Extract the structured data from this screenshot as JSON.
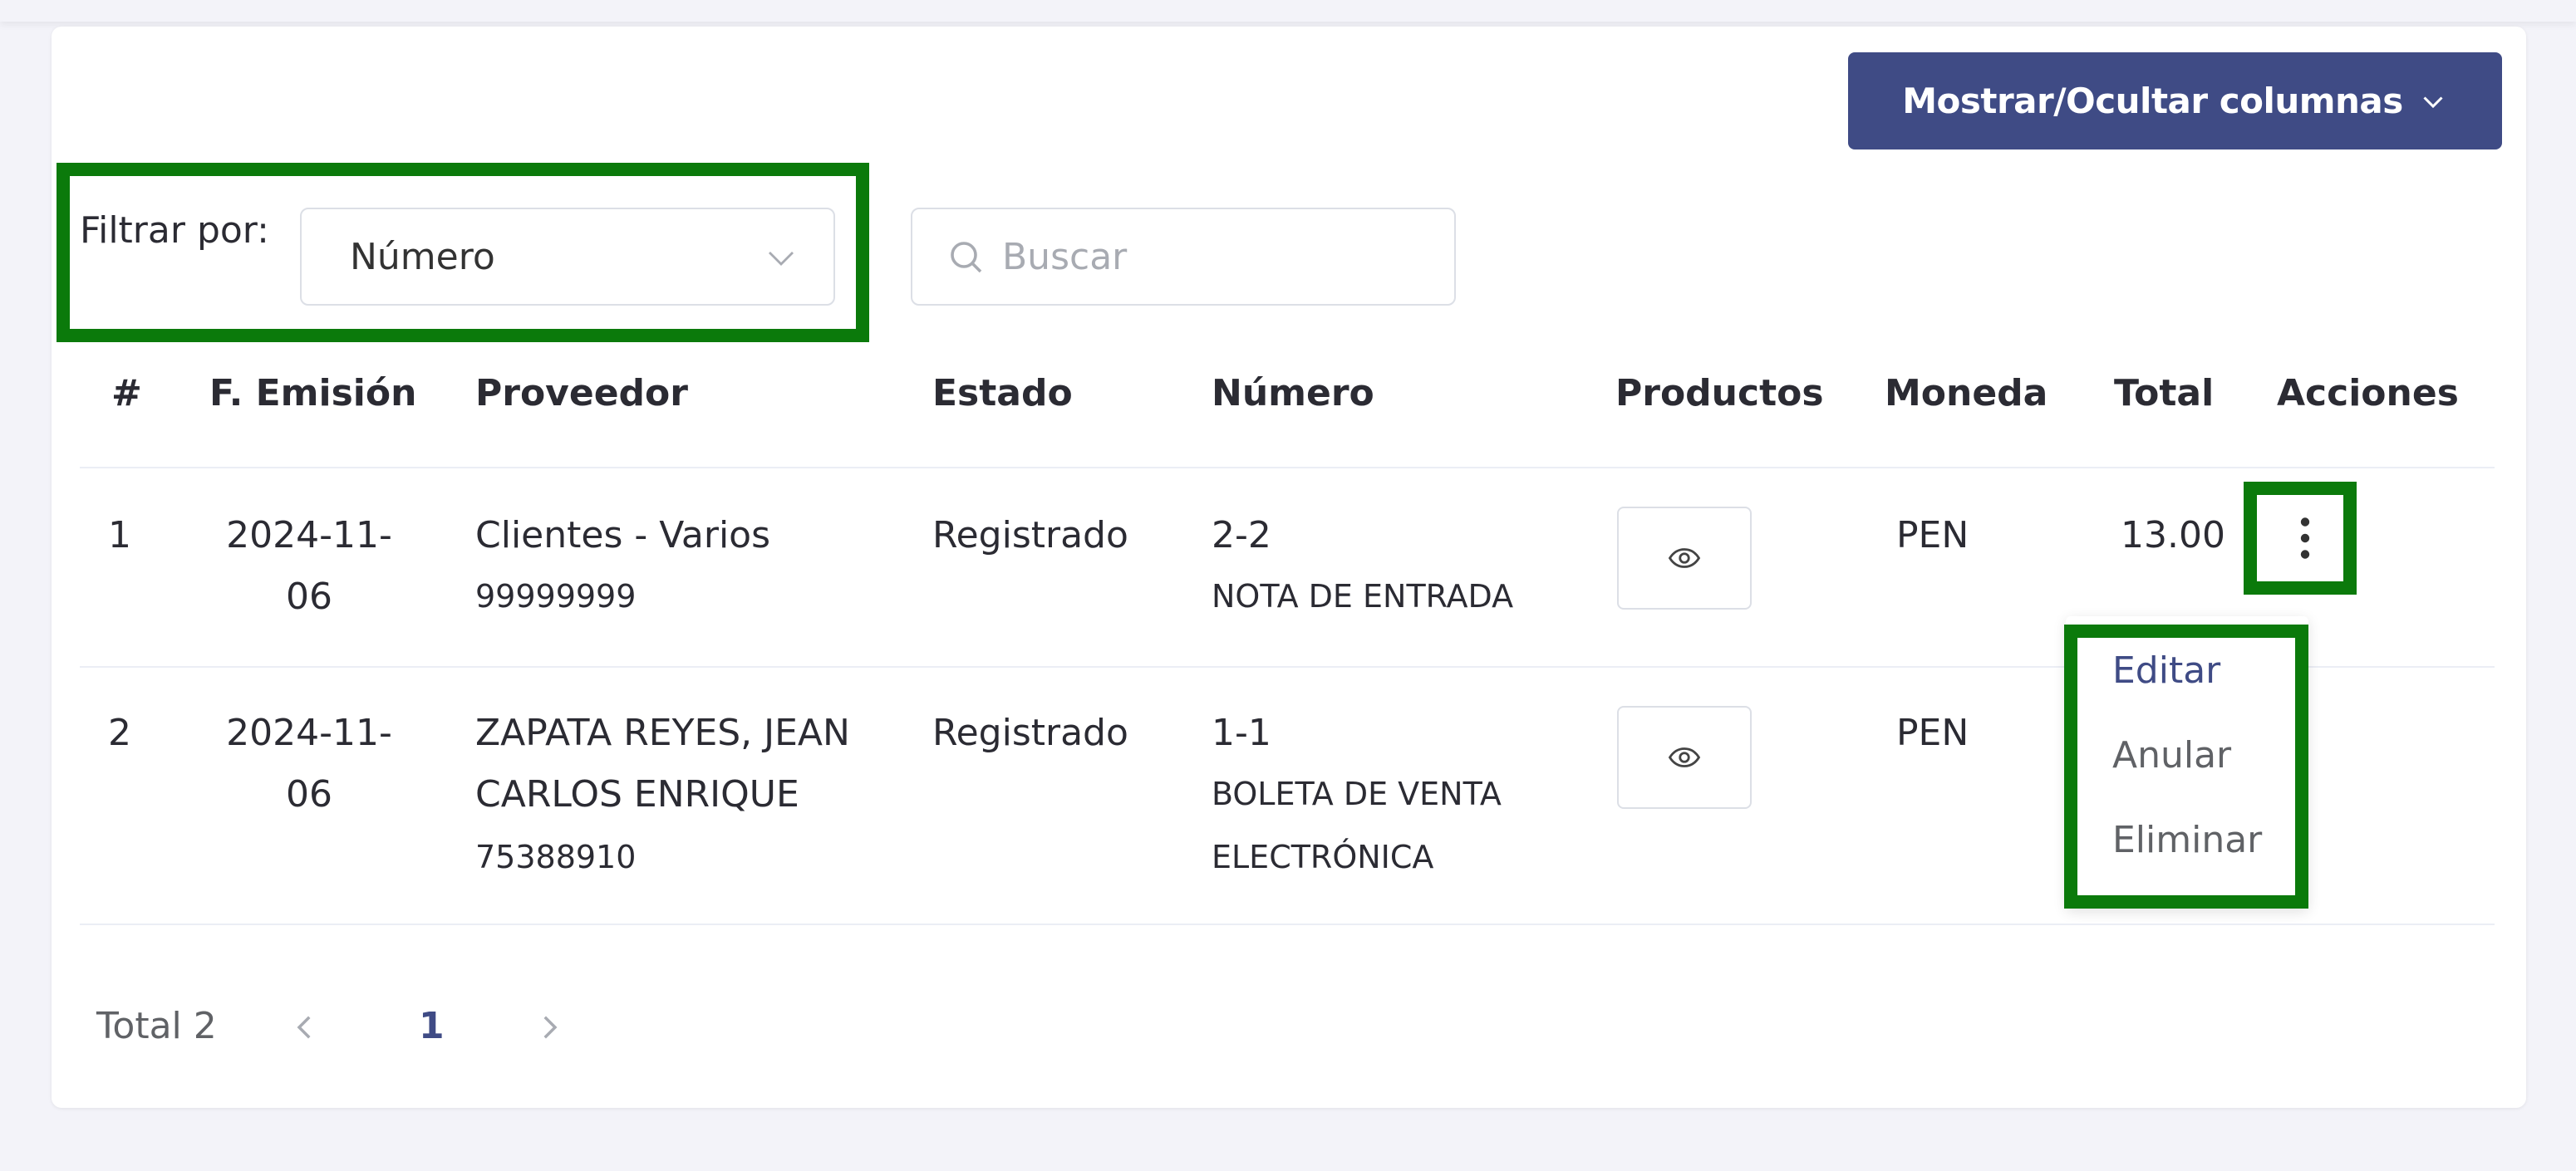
{
  "toolbar": {
    "columns_label": "Mostrar/Ocultar columnas"
  },
  "filter": {
    "label": "Filtrar por:",
    "selected": "Número"
  },
  "search": {
    "placeholder": "Buscar"
  },
  "table": {
    "headers": [
      "#",
      "F. Emisión",
      "Proveedor",
      "Estado",
      "Número",
      "Productos",
      "Moneda",
      "Total",
      "Acciones"
    ],
    "rows": [
      {
        "index": "1",
        "date_line1": "2024-11-",
        "date_line2": "06",
        "supplier_line1": "Clientes - Varios",
        "supplier_line2": "",
        "supplier_doc": "99999999",
        "status": "Registrado",
        "number": "2-2",
        "doc_type_line1": "NOTA DE ENTRADA",
        "doc_type_line2": "",
        "currency": "PEN",
        "total": "13.00"
      },
      {
        "index": "2",
        "date_line1": "2024-11-",
        "date_line2": "06",
        "supplier_line1": "ZAPATA REYES, JEAN",
        "supplier_line2": "CARLOS ENRIQUE",
        "supplier_doc": "75388910",
        "status": "Registrado",
        "number": "1-1",
        "doc_type_line1": "BOLETA DE VENTA",
        "doc_type_line2": "ELECTRÓNICA",
        "currency": "PEN",
        "total": ""
      }
    ]
  },
  "actions_menu": {
    "items": [
      "Editar",
      "Anular",
      "Eliminar"
    ]
  },
  "pagination": {
    "total_label": "Total 2",
    "current_page": "1"
  },
  "colors": {
    "primary": "#3f4b85",
    "highlight": "#0b7a0b"
  },
  "icons": [
    "chevron-down-icon",
    "search-icon",
    "eye-icon",
    "kebab-icon",
    "chevron-left-icon",
    "chevron-right-icon"
  ]
}
